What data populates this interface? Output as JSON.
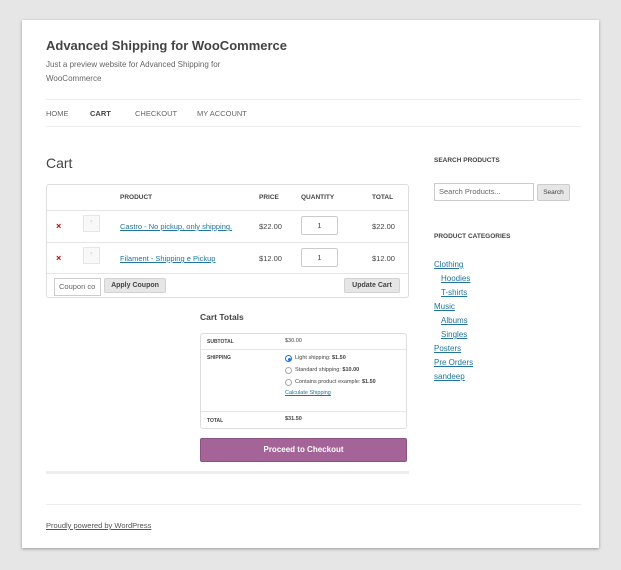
{
  "site": {
    "title": "Advanced Shipping for WooCommerce",
    "description": "Just a preview website for Advanced Shipping for WooCommerce"
  },
  "nav": {
    "items": [
      {
        "label": "HOME"
      },
      {
        "label": "CART"
      },
      {
        "label": "CHECKOUT"
      },
      {
        "label": "MY ACCOUNT"
      }
    ],
    "active": "CART"
  },
  "cart": {
    "title": "Cart",
    "headers": {
      "product": "PRODUCT",
      "price": "PRICE",
      "quantity": "QUANTITY",
      "total": "TOTAL"
    },
    "rows": [
      {
        "remove": "×",
        "name": "Castro - No pickup, only shipping.",
        "price": "$22.00",
        "quantity": "1",
        "total": "$22.00"
      },
      {
        "remove": "×",
        "name": "Filament - Shipping e Pickup",
        "price": "$12.00",
        "quantity": "1",
        "total": "$12.00"
      }
    ],
    "coupon_placeholder": "Coupon co",
    "apply_coupon": "Apply Coupon",
    "update_cart": "Update Cart"
  },
  "totals": {
    "title": "Cart Totals",
    "subtotal_label": "SUBTOTAL",
    "subtotal_value": "$30.00",
    "shipping_label": "SHIPPING",
    "options": [
      {
        "label": "Light shipping: ",
        "price": "$1.50",
        "selected": true
      },
      {
        "label": "Standard shipping: ",
        "price": "$10.00",
        "selected": false
      },
      {
        "label": "Contains product example: ",
        "price": "$1.50",
        "selected": false
      }
    ],
    "calculate_shipping": "Calculate Shipping",
    "total_label": "TOTAL",
    "total_value": "$31.50",
    "checkout_button": "Proceed to Checkout"
  },
  "sidebar": {
    "search_title": "SEARCH PRODUCTS",
    "search_placeholder": "Search Products...",
    "search_button": "Search",
    "categories_title": "PRODUCT CATEGORIES",
    "categories": [
      {
        "label": "Clothing",
        "indent": false
      },
      {
        "label": "Hoodies",
        "indent": true
      },
      {
        "label": "T-shirts",
        "indent": true
      },
      {
        "label": "Music",
        "indent": false
      },
      {
        "label": "Albums",
        "indent": true
      },
      {
        "label": "Singles",
        "indent": true
      },
      {
        "label": "Posters",
        "indent": false
      },
      {
        "label": "Pre Orders",
        "indent": false
      },
      {
        "label": "sandeep",
        "indent": false
      }
    ]
  },
  "footer": {
    "text": "Proudly powered by WordPress"
  },
  "colors": {
    "accent": "#a46497",
    "link": "#21759b",
    "remove": "#cc0000"
  }
}
